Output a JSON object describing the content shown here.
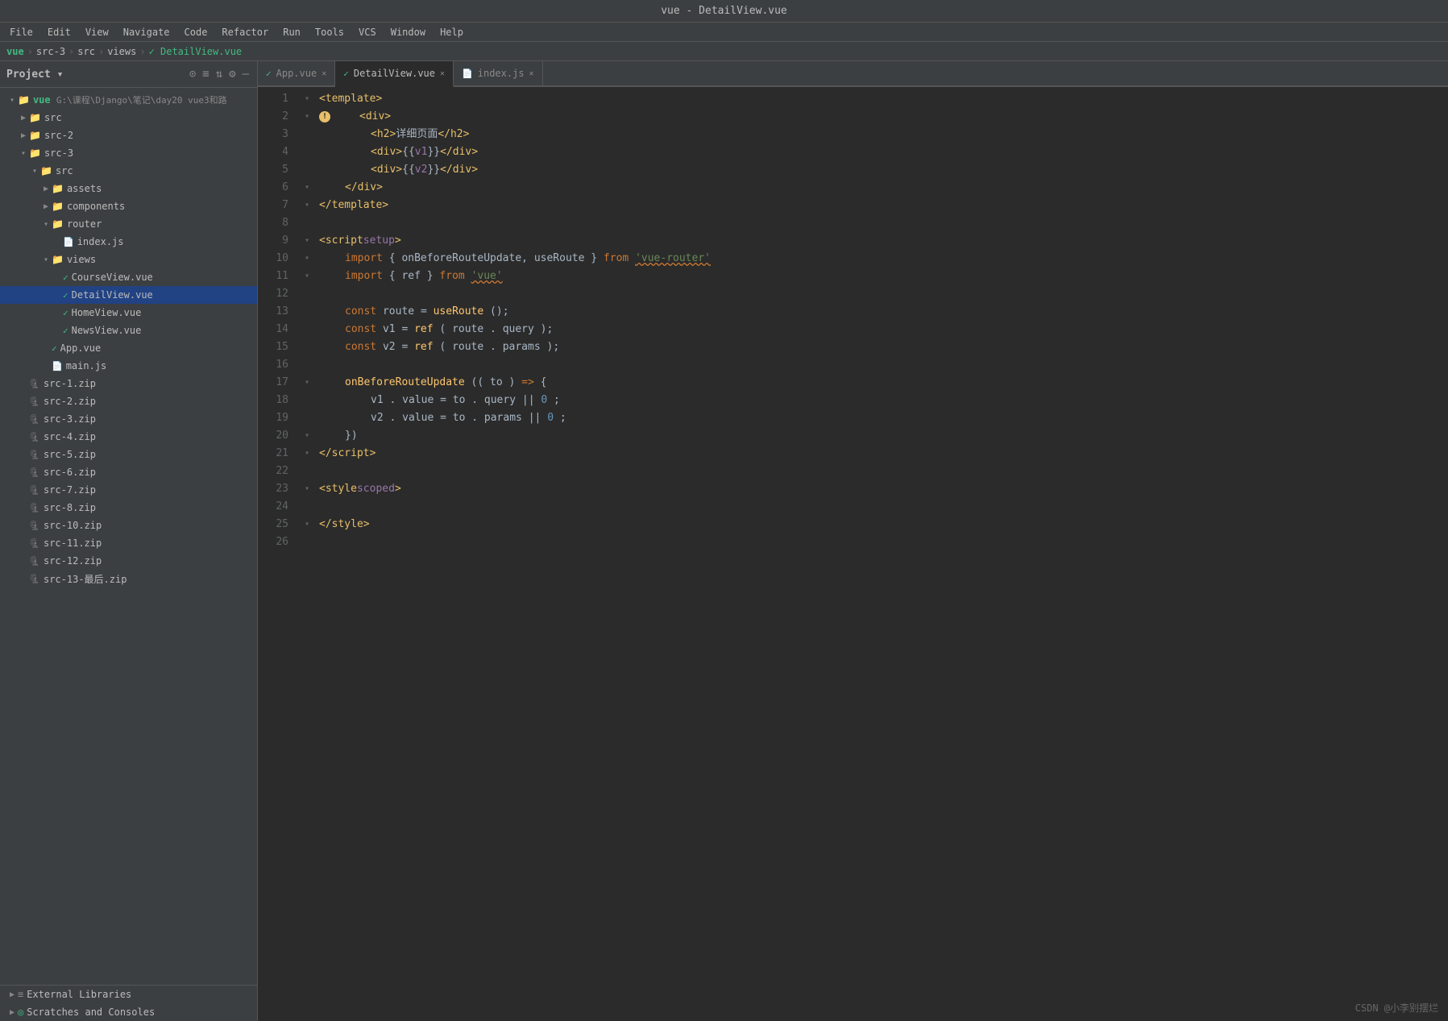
{
  "title": "vue - DetailView.vue",
  "menu": {
    "items": [
      "File",
      "Edit",
      "View",
      "Navigate",
      "Code",
      "Refactor",
      "Run",
      "Tools",
      "VCS",
      "Window",
      "Help"
    ]
  },
  "breadcrumb": {
    "parts": [
      "vue",
      "src-3",
      "src",
      "views",
      "DetailView.vue"
    ]
  },
  "sidebar": {
    "title": "Project",
    "tree": [
      {
        "id": "vue-root",
        "label": "vue G:\\课程\\Django\\笔记\\day20 vue3和路",
        "indent": 1,
        "type": "folder",
        "expanded": true
      },
      {
        "id": "src",
        "label": "src",
        "indent": 2,
        "type": "folder",
        "expanded": false
      },
      {
        "id": "src-2",
        "label": "src-2",
        "indent": 2,
        "type": "folder",
        "expanded": false
      },
      {
        "id": "src-3",
        "label": "src-3",
        "indent": 2,
        "type": "folder",
        "expanded": true
      },
      {
        "id": "src3-src",
        "label": "src",
        "indent": 3,
        "type": "folder",
        "expanded": true
      },
      {
        "id": "assets",
        "label": "assets",
        "indent": 4,
        "type": "folder",
        "expanded": false
      },
      {
        "id": "components",
        "label": "components",
        "indent": 4,
        "type": "folder",
        "expanded": false
      },
      {
        "id": "router",
        "label": "router",
        "indent": 4,
        "type": "folder",
        "expanded": true
      },
      {
        "id": "index-js",
        "label": "index.js",
        "indent": 5,
        "type": "js"
      },
      {
        "id": "views",
        "label": "views",
        "indent": 4,
        "type": "folder",
        "expanded": true
      },
      {
        "id": "courseview",
        "label": "CourseView.vue",
        "indent": 5,
        "type": "vue"
      },
      {
        "id": "detailview",
        "label": "DetailView.vue",
        "indent": 5,
        "type": "vue",
        "selected": true
      },
      {
        "id": "homeview",
        "label": "HomeView.vue",
        "indent": 5,
        "type": "vue"
      },
      {
        "id": "newsview",
        "label": "NewsView.vue",
        "indent": 5,
        "type": "vue"
      },
      {
        "id": "app-vue",
        "label": "App.vue",
        "indent": 4,
        "type": "vue"
      },
      {
        "id": "main-js",
        "label": "main.js",
        "indent": 4,
        "type": "js"
      },
      {
        "id": "src-1-zip",
        "label": "src-1.zip",
        "indent": 2,
        "type": "zip"
      },
      {
        "id": "src-2-zip",
        "label": "src-2.zip",
        "indent": 2,
        "type": "zip"
      },
      {
        "id": "src-3-zip",
        "label": "src-3.zip",
        "indent": 2,
        "type": "zip"
      },
      {
        "id": "src-4-zip",
        "label": "src-4.zip",
        "indent": 2,
        "type": "zip"
      },
      {
        "id": "src-5-zip",
        "label": "src-5.zip",
        "indent": 2,
        "type": "zip"
      },
      {
        "id": "src-6-zip",
        "label": "src-6.zip",
        "indent": 2,
        "type": "zip"
      },
      {
        "id": "src-7-zip",
        "label": "src-7.zip",
        "indent": 2,
        "type": "zip"
      },
      {
        "id": "src-8-zip",
        "label": "src-8.zip",
        "indent": 2,
        "type": "zip"
      },
      {
        "id": "src-10-zip",
        "label": "src-10.zip",
        "indent": 2,
        "type": "zip"
      },
      {
        "id": "src-11-zip",
        "label": "src-11.zip",
        "indent": 2,
        "type": "zip"
      },
      {
        "id": "src-12-zip",
        "label": "src-12.zip",
        "indent": 2,
        "type": "zip"
      },
      {
        "id": "src-13-zip",
        "label": "src-13-最后.zip",
        "indent": 2,
        "type": "zip"
      }
    ],
    "external_libraries": "External Libraries",
    "scratches": "Scratches and Consoles"
  },
  "tabs": [
    {
      "label": "App.vue",
      "type": "vue",
      "active": false
    },
    {
      "label": "DetailView.vue",
      "type": "vue",
      "active": true
    },
    {
      "label": "index.js",
      "type": "js",
      "active": false
    }
  ],
  "watermark": "CSDN @小李别摆烂"
}
